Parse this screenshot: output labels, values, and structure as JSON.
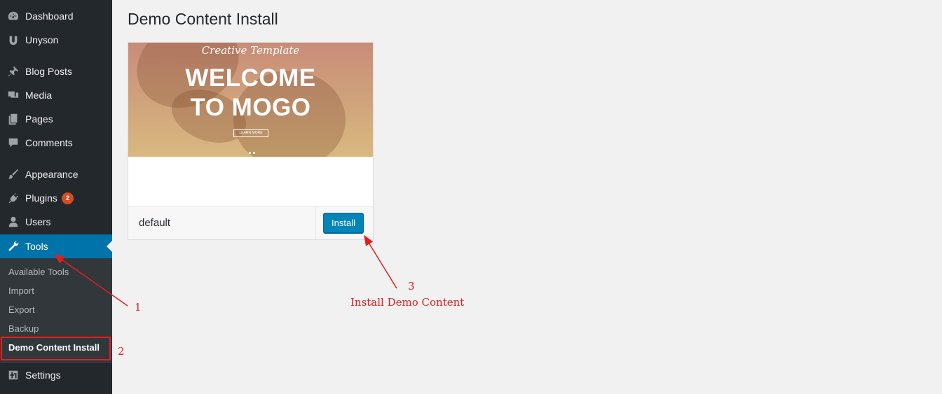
{
  "sidebar": {
    "items": [
      {
        "label": "Dashboard",
        "icon": "dashboard-icon"
      },
      {
        "label": "Unyson",
        "icon": "unyson-icon"
      },
      {
        "label": "Blog Posts",
        "icon": "pin-icon"
      },
      {
        "label": "Media",
        "icon": "media-icon"
      },
      {
        "label": "Pages",
        "icon": "pages-icon"
      },
      {
        "label": "Comments",
        "icon": "comments-icon"
      },
      {
        "label": "Appearance",
        "icon": "brush-icon"
      },
      {
        "label": "Plugins",
        "icon": "plug-icon",
        "badge": "2"
      },
      {
        "label": "Users",
        "icon": "user-icon"
      },
      {
        "label": "Tools",
        "icon": "wrench-icon"
      },
      {
        "label": "Settings",
        "icon": "sliders-icon"
      }
    ],
    "submenu": [
      "Available Tools",
      "Import",
      "Export",
      "Backup",
      "Demo Content Install"
    ]
  },
  "main": {
    "title": "Demo Content Install",
    "card": {
      "preview_script": "Creative Template",
      "preview_heading_line1": "WELCOME",
      "preview_heading_line2": "TO MOGO",
      "preview_button": "LEARN MORE",
      "name": "default",
      "install_label": "Install"
    }
  },
  "annotations": {
    "label1": "1",
    "label2": "2",
    "label3": "3",
    "label3_text": "Install Demo Content",
    "color": "#e02020"
  },
  "colors": {
    "sidebar_bg": "#23282d",
    "active_bg": "#0073aa",
    "button_bg": "#0085ba",
    "badge_bg": "#d54e21"
  }
}
